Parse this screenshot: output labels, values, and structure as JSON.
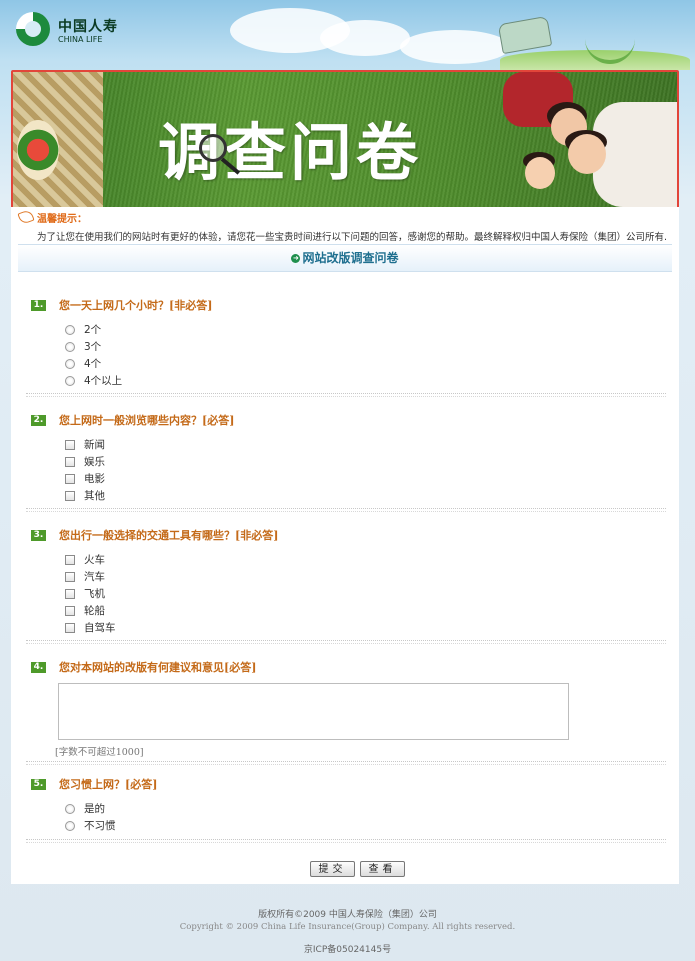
{
  "brand": {
    "name_cn": "中国人寿",
    "name_en": "CHINA LIFE"
  },
  "banner": {
    "title": "调查问卷"
  },
  "tips": {
    "title": "温馨提示：",
    "text": "为了让您在使用我们的网站时有更好的体验，请您花一些宝贵时间进行以下问题的回答，感谢您的帮助。最终解释权归中国人寿保险（集团）公司所有."
  },
  "survey": {
    "title": "网站改版调查问卷",
    "questions": [
      {
        "number": "1.",
        "text": "您一天上网几个小时？[非必答]",
        "type": "radio",
        "options": [
          "2个",
          "3个",
          "4个",
          "4个以上"
        ]
      },
      {
        "number": "2.",
        "text": "您上网时一般浏览哪些内容？[必答]",
        "type": "checkbox",
        "options": [
          "新闻",
          "娱乐",
          "电影",
          "其他"
        ]
      },
      {
        "number": "3.",
        "text": "您出行一般选择的交通工具有哪些？[非必答]",
        "type": "checkbox",
        "options": [
          "火车",
          "汽车",
          "飞机",
          "轮船",
          "自驾车"
        ]
      },
      {
        "number": "4.",
        "text": "您对本网站的改版有何建议和意见[必答]",
        "type": "textarea",
        "value": "",
        "limit_note": "[字数不可超过1000]"
      },
      {
        "number": "5.",
        "text": "您习惯上网？[必答]",
        "type": "radio",
        "options": [
          "是的",
          "不习惯"
        ]
      }
    ],
    "buttons": {
      "submit": "提交",
      "view": "查看"
    }
  },
  "footer": {
    "copyright_cn": "版权所有©2009 中国人寿保险（集团）公司",
    "copyright_en": "Copyright © 2009 China Life Insurance(Group) Company. All rights reserved.",
    "icp": "京ICP备05024145号"
  },
  "colors": {
    "accent_orange": "#c46a19",
    "question_number_green": "#4e9a2a",
    "banner_border_red": "#e2453a",
    "header_title_blue": "#1f6f8f"
  }
}
